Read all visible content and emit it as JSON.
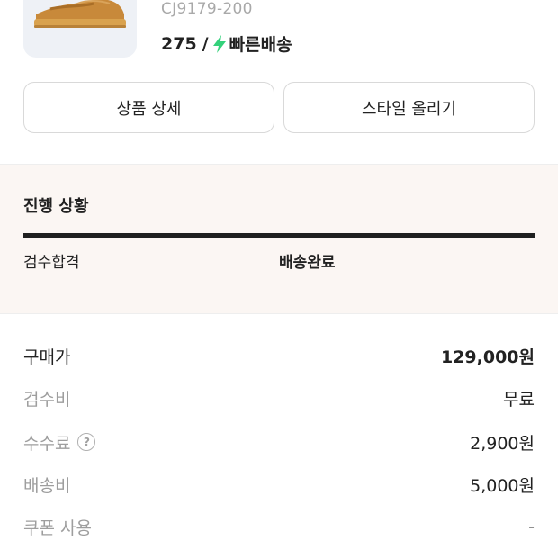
{
  "product": {
    "code": "CJ9179-200",
    "size": "275",
    "separator": "/",
    "delivery_label": "빠른배송",
    "delivery_icon": "lightning-bolt-icon",
    "accent_color": "#33d17a"
  },
  "actions": {
    "detail_label": "상품 상세",
    "style_label": "스타일 올리기"
  },
  "progress": {
    "title": "진행 상황",
    "steps": [
      {
        "label": "검수합격",
        "active": false
      },
      {
        "label": "배송완료",
        "active": true
      }
    ]
  },
  "pricing": {
    "rows": [
      {
        "label": "구매가",
        "value": "129,000원"
      },
      {
        "label": "검수비",
        "value": "무료"
      },
      {
        "label": "수수료",
        "value": "2,900원",
        "help_icon": "?"
      },
      {
        "label": "배송비",
        "value": "5,000원"
      },
      {
        "label": "쿠폰 사용",
        "value": "-"
      }
    ]
  }
}
